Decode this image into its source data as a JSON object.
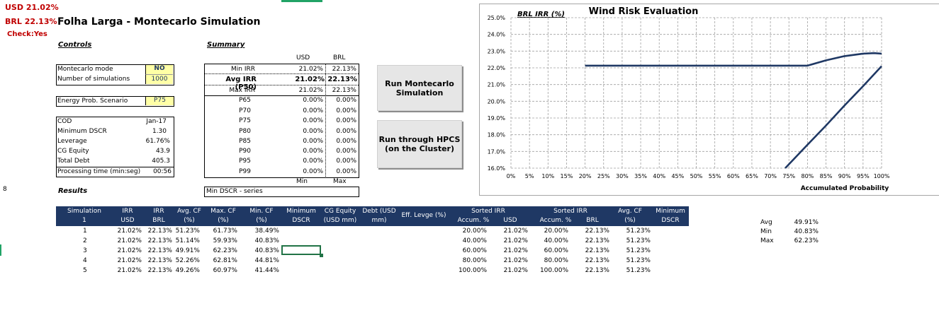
{
  "header": {
    "usd_label": "USD 21.02%",
    "brl_label": "BRL 22.13%",
    "check_label": "Check:Yes",
    "title": "Folha Larga - Montecarlo Simulation"
  },
  "controls": {
    "heading": "Controls",
    "montecarlo_mode_label": "Montecarlo mode",
    "montecarlo_mode_value": "NO",
    "num_simulations_label": "Number of simulations",
    "num_simulations_value": "1000",
    "energy_label": "Energy Prob. Scenario",
    "energy_value": "P75",
    "params": [
      {
        "label": "COD",
        "value": "Jan-17"
      },
      {
        "label": "Minimum DSCR",
        "value": "1.30"
      },
      {
        "label": "Leverage",
        "value": "61.76%"
      },
      {
        "label": "CG Equity",
        "value": "43.9"
      },
      {
        "label": "Total Debt",
        "value": "405.3"
      },
      {
        "label": "Processing time (min:seg)",
        "value": "00:56"
      }
    ]
  },
  "summary": {
    "heading": "Summary",
    "col_usd": "USD",
    "col_brl": "BRL",
    "rows": [
      {
        "label": "Min IRR",
        "usd": "21.02%",
        "brl": "22.13%"
      },
      {
        "label": "Avg IRR (P50)",
        "usd": "21.02%",
        "brl": "22.13%"
      },
      {
        "label": "Max IRR",
        "usd": "21.02%",
        "brl": "22.13%"
      },
      {
        "label": "P65",
        "usd": "0.00%",
        "brl": "0.00%"
      },
      {
        "label": "P70",
        "usd": "0.00%",
        "brl": "0.00%"
      },
      {
        "label": "P75",
        "usd": "0.00%",
        "brl": "0.00%"
      },
      {
        "label": "P80",
        "usd": "0.00%",
        "brl": "0.00%"
      },
      {
        "label": "P85",
        "usd": "0.00%",
        "brl": "0.00%"
      },
      {
        "label": "P90",
        "usd": "0.00%",
        "brl": "0.00%"
      },
      {
        "label": "P95",
        "usd": "0.00%",
        "brl": "0.00%"
      },
      {
        "label": "P99",
        "usd": "0.00%",
        "brl": "0.00%"
      }
    ],
    "foot_min": "Min",
    "foot_max": "Max",
    "dscr_series_label": "Min DSCR - series"
  },
  "buttons": {
    "run_montecarlo": "Run Montecarlo Simulation",
    "run_hpcs": "Run through HPCS (on the Cluster)"
  },
  "results": {
    "heading": "Results",
    "headers": {
      "simulation": "Simulation",
      "sim_sub": "1",
      "irr_usd_1": "IRR",
      "irr_usd_2": "USD",
      "irr_brl_1": "IRR",
      "irr_brl_2": "BRL",
      "avg_cf_1": "Avg. CF",
      "avg_cf_2": "(%)",
      "max_cf_1": "Max. CF",
      "max_cf_2": "(%)",
      "min_cf_1": "Min. CF",
      "min_cf_2": "(%)",
      "min_dscr_1": "Minimum",
      "min_dscr_2": "DSCR",
      "cg_equity_1": "CG Equity",
      "cg_equity_2": "(USD mm)",
      "debt_1": "Debt (USD",
      "debt_2": "mm)",
      "eff_levge": "Eff. Levge (%)",
      "sorted_irr_a": "Sorted IRR",
      "accum_a": "Accum. %",
      "usd_a": "USD",
      "sorted_irr_b": "Sorted IRR",
      "accum_b": "Accum. %",
      "brl_b": "BRL",
      "avg_cf_r1": "Avg. CF",
      "avg_cf_r2": "(%)",
      "min_dscr_r1": "Minimum",
      "min_dscr_r2": "DSCR"
    },
    "rows": [
      {
        "sim": "1",
        "irr_usd": "21.02%",
        "irr_brl": "22.13%",
        "avg_cf": "51.23%",
        "max_cf": "61.73%",
        "min_cf": "38.49%"
      },
      {
        "sim": "2",
        "irr_usd": "21.02%",
        "irr_brl": "22.13%",
        "avg_cf": "51.14%",
        "max_cf": "59.93%",
        "min_cf": "40.83%"
      },
      {
        "sim": "3",
        "irr_usd": "21.02%",
        "irr_brl": "22.13%",
        "avg_cf": "49.91%",
        "max_cf": "62.23%",
        "min_cf": "40.83%"
      },
      {
        "sim": "4",
        "irr_usd": "21.02%",
        "irr_brl": "22.13%",
        "avg_cf": "52.26%",
        "max_cf": "62.81%",
        "min_cf": "44.81%"
      },
      {
        "sim": "5",
        "irr_usd": "21.02%",
        "irr_brl": "22.13%",
        "avg_cf": "49.26%",
        "max_cf": "60.97%",
        "min_cf": "41.44%"
      }
    ],
    "sorted_rows": [
      {
        "accum_a": "20.00%",
        "usd": "21.02%",
        "accum_b": "20.00%",
        "brl": "22.13%",
        "avg_cf": "51.23%"
      },
      {
        "accum_a": "40.00%",
        "usd": "21.02%",
        "accum_b": "40.00%",
        "brl": "22.13%",
        "avg_cf": "51.23%"
      },
      {
        "accum_a": "60.00%",
        "usd": "21.02%",
        "accum_b": "60.00%",
        "brl": "22.13%",
        "avg_cf": "51.23%"
      },
      {
        "accum_a": "80.00%",
        "usd": "21.02%",
        "accum_b": "80.00%",
        "brl": "22.13%",
        "avg_cf": "51.23%"
      },
      {
        "accum_a": "100.00%",
        "usd": "21.02%",
        "accum_b": "100.00%",
        "brl": "22.13%",
        "avg_cf": "51.23%"
      }
    ],
    "stats": [
      {
        "label": "Avg",
        "value": "49.91%"
      },
      {
        "label": "Min",
        "value": "40.83%"
      },
      {
        "label": "Max",
        "value": "62.23%"
      }
    ]
  },
  "row_marker": "8",
  "chart_data": {
    "type": "line",
    "title": "Wind Risk Evaluation",
    "ylabel": "BRL IRR (%)",
    "xlabel": "Accumulated Probability",
    "x_ticks": [
      "0%",
      "5%",
      "10%",
      "15%",
      "20%",
      "25%",
      "30%",
      "35%",
      "40%",
      "45%",
      "50%",
      "55%",
      "60%",
      "65%",
      "70%",
      "75%",
      "80%",
      "85%",
      "90%",
      "95%",
      "100%"
    ],
    "y_ticks": [
      "16.0%",
      "17.0%",
      "18.0%",
      "19.0%",
      "20.0%",
      "21.0%",
      "22.0%",
      "23.0%",
      "24.0%",
      "25.0%"
    ],
    "xlim": [
      0,
      100
    ],
    "ylim": [
      16,
      25
    ],
    "grid": true,
    "series": [
      {
        "x": [
          20,
          80,
          85,
          90,
          95,
          98,
          100
        ],
        "y": [
          22.13,
          22.13,
          22.45,
          22.7,
          22.85,
          22.88,
          22.85
        ]
      },
      {
        "x": [
          74,
          80,
          85,
          90,
          95,
          100
        ],
        "y": [
          16.0,
          17.4,
          18.55,
          19.75,
          20.9,
          22.1
        ]
      }
    ],
    "line_color": "#1f3864"
  }
}
